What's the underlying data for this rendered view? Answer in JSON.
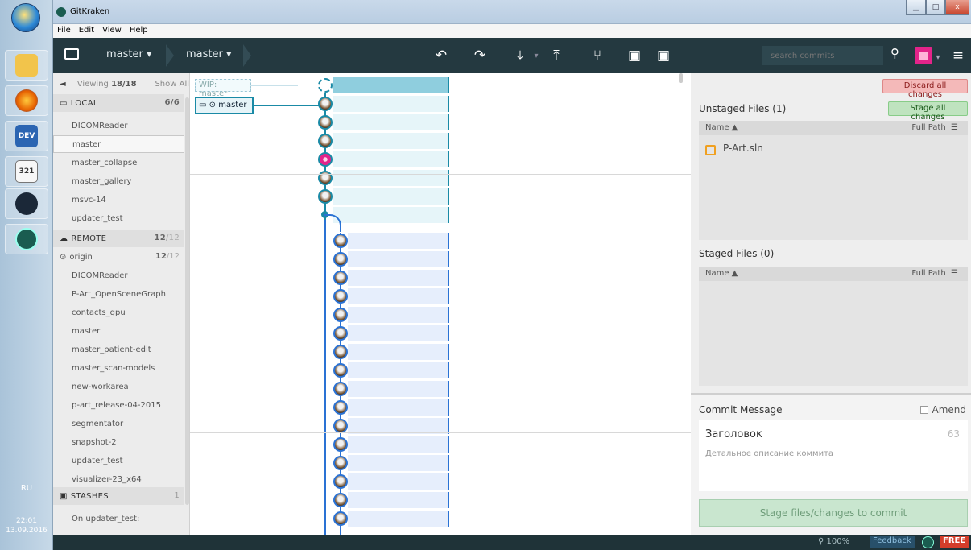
{
  "taskbar": {
    "lang": "RU",
    "time": "22:01",
    "date": "13.09.2016",
    "apps": [
      {
        "icon": "file-explorer-icon",
        "color": "#f2c44b",
        "label": ""
      },
      {
        "icon": "firefox-icon",
        "color": "#e66000",
        "label": ""
      },
      {
        "icon": "devexpress-icon",
        "color": "#2b65b2",
        "label": "DEV"
      },
      {
        "icon": "media-player-icon",
        "color": "#f7f7f7",
        "label": "321"
      },
      {
        "icon": "steam-icon",
        "color": "#1b2838",
        "label": ""
      },
      {
        "icon": "gitkraken-icon",
        "color": "#1a5c50",
        "label": ""
      }
    ]
  },
  "window": {
    "title": "GitKraken",
    "menu": [
      "File",
      "Edit",
      "View",
      "Help"
    ]
  },
  "toolbar": {
    "repo_branch": "master",
    "branch": "master",
    "undo_icon": "undo-icon",
    "redo_icon": "redo-icon",
    "pull_icon": "pull-icon",
    "push_icon": "push-icon",
    "branch_icon": "branch-icon",
    "stash_icon": "stash-icon",
    "pop_icon": "pop-icon",
    "search_placeholder": "search commits"
  },
  "left_panel": {
    "viewing_label": "Viewing",
    "viewing_count": "18/18",
    "show_all": "Show All",
    "local": {
      "label": "LOCAL",
      "count": "6/6",
      "branches": [
        "DICOMReader",
        "master",
        "master_collapse",
        "master_gallery",
        "msvc-14",
        "updater_test"
      ],
      "selected": "master"
    },
    "remote": {
      "label": "REMOTE",
      "count_a": "12",
      "count_b": "/12",
      "origin": {
        "label": "origin",
        "count_a": "12",
        "count_b": "/12"
      },
      "branches": [
        "DICOMReader",
        "P-Art_OpenSceneGraph",
        "contacts_gpu",
        "master",
        "master_patient-edit",
        "master_scan-models",
        "new-workarea",
        "p-art_release-04-2015",
        "segmentator",
        "snapshot-2",
        "updater_test",
        "visualizer-23_x64"
      ]
    },
    "stashes": {
      "label": "STASHES",
      "count": "1",
      "items": [
        "On updater_test:"
      ]
    }
  },
  "graph": {
    "wip_label": "WIP: master",
    "head_label": "master",
    "local_commits": 7,
    "remote_commits": 16
  },
  "right_panel": {
    "discard_label": "Discard all changes",
    "stage_all_label": "Stage all changes",
    "unstaged_title": "Unstaged Files (1)",
    "staged_title": "Staged Files (0)",
    "col_name": "Name ▲",
    "col_full_path": "Full Path",
    "unstaged_files": [
      "P-Art.sln"
    ],
    "commit_message_label": "Commit Message",
    "amend_label": "Amend",
    "summary_placeholder": "Заголовок",
    "summary_remaining": "63",
    "description_placeholder": "Детальное описание коммита",
    "stage_button": "Stage files/changes to commit"
  },
  "status_bar": {
    "zoom": "100%",
    "feedback": "Feedback",
    "license": "FREE"
  }
}
